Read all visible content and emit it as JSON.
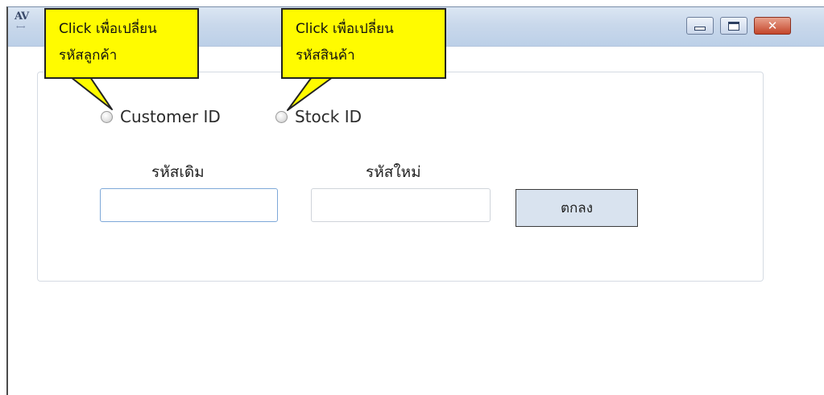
{
  "window": {
    "icon_text": "AV",
    "controls": {
      "minimize": "minimize",
      "maximize": "maximize",
      "close": "close"
    }
  },
  "callouts": [
    {
      "line1": "Click เพื่อเปลี่ยน",
      "line2": "รหัสลูกค้า"
    },
    {
      "line1": "Click เพื่อเปลี่ยน",
      "line2": "รหัสสินค้า"
    }
  ],
  "radios": {
    "customer_label": "Customer ID",
    "stock_label": "Stock ID"
  },
  "form": {
    "old_code_label": "รหัสเดิม",
    "new_code_label": "รหัสใหม่",
    "old_code_value": "",
    "new_code_value": "",
    "ok_label": "ตกลง"
  },
  "colors": {
    "callout": "#fffb00",
    "titlebar": "#c9d8eb",
    "button": "#d9e3ef",
    "close": "#c4462b"
  }
}
